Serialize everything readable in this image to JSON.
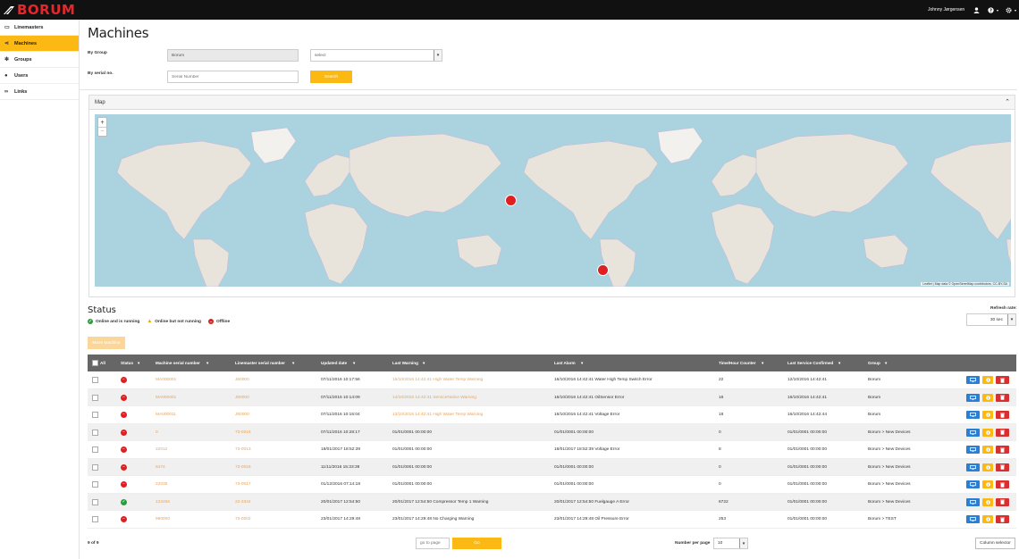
{
  "app": {
    "logo": "BORUM",
    "user_name": "Johnny Jørgensen"
  },
  "colors": {
    "accent": "#fdb913",
    "topbar": "#111111",
    "link": "#e9a35a",
    "offline": "#e02020",
    "online": "#2a9d3a",
    "header": "#666666"
  },
  "sidebar": {
    "items": [
      {
        "label": "Linemasters",
        "icon": "monitor-icon",
        "active": false
      },
      {
        "label": "Machines",
        "icon": "share-icon",
        "active": true
      },
      {
        "label": "Groups",
        "icon": "cogs-icon",
        "active": false
      },
      {
        "label": "Users",
        "icon": "user-icon",
        "active": false
      },
      {
        "label": "Links",
        "icon": "link-icon",
        "active": false
      }
    ]
  },
  "page": {
    "title": "Machines"
  },
  "filters": {
    "by_group_label": "By Group",
    "group_value": "Borum",
    "group_select": "select",
    "serial_label": "By serial no.",
    "serial_placeholder": "Serial Number",
    "search_label": "Search"
  },
  "map": {
    "title": "Map",
    "attribution": "Leaflet | Map data © OpenStreetMap contributors, CC-BY-SA"
  },
  "status": {
    "title": "Status",
    "legend": [
      {
        "label": "Online and is running"
      },
      {
        "label": "Online but not running"
      },
      {
        "label": "Offline"
      }
    ],
    "refresh_label": "Refresh rate:",
    "refresh_value": "30 sec",
    "move_label": "Move Machine"
  },
  "table": {
    "headers": [
      "All",
      "Status",
      "Machine serial number",
      "Linemaster serial number",
      "Updated date",
      "Last Warning",
      "Last Alarm",
      "Time/Hour Counter",
      "Last Service Confirmed",
      "Group"
    ],
    "rows": [
      {
        "status": "offline",
        "serial": "MA000001",
        "linemaster": "J60000",
        "updated": "07/11/2016 10:17:56",
        "warning": "15/10/2016 14:42:41 High Water Temp Warning",
        "alarm": "16/10/2016 14:42:41 Water High Temp Switch Error",
        "counter": "22",
        "service": "12/10/2016 14:42:41",
        "group": "Borum"
      },
      {
        "status": "offline",
        "serial": "MA000001",
        "linemaster": "J60000",
        "updated": "07/11/2016 10:14:09",
        "warning": "14/10/2016 14:42:41 ServiceNotice Warning",
        "alarm": "16/10/2016 14:42:41 OilSensor Error",
        "counter": "16",
        "service": "16/10/2016 14:42:41",
        "group": "Borum"
      },
      {
        "status": "offline",
        "serial": "MA000011",
        "linemaster": "J60000",
        "updated": "07/11/2016 10:15:04",
        "warning": "13/10/2016 14:42:41 High Water Temp Warning",
        "alarm": "16/10/2016 14:42:41 Voltage Error",
        "counter": "18",
        "service": "16/10/2016 14:42:44",
        "group": "Borum"
      },
      {
        "status": "offline",
        "serial": "0",
        "linemaster": "73-0018",
        "updated": "07/11/2016 10:28:17",
        "warning": "01/01/0001 00:00:00",
        "alarm": "01/01/0001 00:00:00",
        "counter": "0",
        "service": "01/01/0001 00:00:00",
        "group": "Borum > New Devices"
      },
      {
        "status": "offline",
        "serial": "22012",
        "linemaster": "73-0013",
        "updated": "18/01/2017 18:52:39",
        "warning": "01/01/0001 00:00:00",
        "alarm": "18/01/2017 18:52:39 Voltage Error",
        "counter": "8",
        "service": "01/01/0001 00:00:00",
        "group": "Borum > New Devices"
      },
      {
        "status": "offline",
        "serial": "6474",
        "linemaster": "73-0018",
        "updated": "11/11/2016 15:33:39",
        "warning": "01/01/0001 00:00:00",
        "alarm": "01/01/0001 00:00:00",
        "counter": "0",
        "service": "01/01/0001 00:00:00",
        "group": "Borum > New Devices"
      },
      {
        "status": "offline",
        "serial": "22035",
        "linemaster": "73-0017",
        "updated": "01/12/2016 07:14:18",
        "warning": "01/01/0001 00:00:00",
        "alarm": "01/01/0001 00:00:00",
        "counter": "0",
        "service": "01/01/0001 00:00:00",
        "group": "Borum > New Devices"
      },
      {
        "status": "online",
        "serial": "123456",
        "linemaster": "22-3344",
        "updated": "20/01/2017 12:54:50",
        "warning": "20/01/2017 12:54:50 Compressor Temp 1 Warning",
        "alarm": "20/01/2017 12:54:50 Fuelgauge A Error",
        "counter": "6722",
        "service": "01/01/0001 00:00:00",
        "group": "Borum > New Devices"
      },
      {
        "status": "offline",
        "serial": "990000",
        "linemaster": "73-0002",
        "updated": "23/01/2017 14:29:48",
        "warning": "23/01/2017 14:29:48 No Charging Warning",
        "alarm": "23/01/2017 14:29:48 Oil Pressure Error",
        "counter": "253",
        "service": "01/01/0001 00:00:00",
        "group": "Borum > TEST"
      }
    ]
  },
  "pager": {
    "count": "9 of 9",
    "goto_placeholder": "go to page",
    "go_label": "Go",
    "per_page_label": "Number per page",
    "per_page_value": "10",
    "column_selector": "Column selector"
  }
}
